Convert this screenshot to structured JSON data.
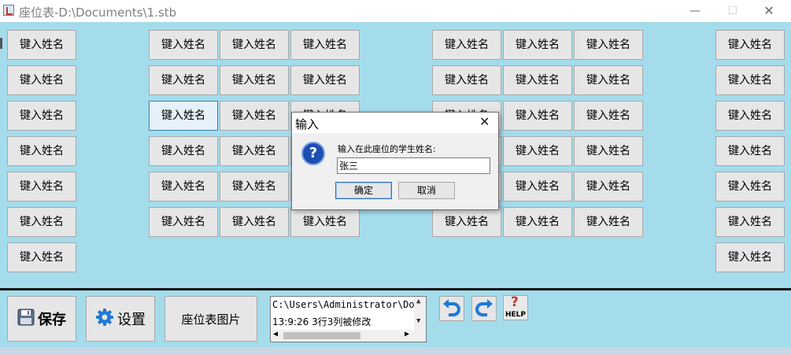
{
  "window": {
    "title": "座位表-D:\\Documents\\1.stb",
    "minimize": "—",
    "maximize": "☐",
    "close": "✕"
  },
  "seat_label": "键入姓名",
  "seats": [
    {
      "row": 1,
      "col": 1
    },
    {
      "row": 1,
      "col": 3
    },
    {
      "row": 1,
      "col": 4
    },
    {
      "row": 1,
      "col": 5
    },
    {
      "row": 1,
      "col": 7
    },
    {
      "row": 1,
      "col": 8
    },
    {
      "row": 1,
      "col": 9
    },
    {
      "row": 1,
      "col": 11
    },
    {
      "row": 2,
      "col": 1
    },
    {
      "row": 2,
      "col": 3
    },
    {
      "row": 2,
      "col": 4
    },
    {
      "row": 2,
      "col": 5
    },
    {
      "row": 2,
      "col": 7
    },
    {
      "row": 2,
      "col": 8
    },
    {
      "row": 2,
      "col": 9
    },
    {
      "row": 2,
      "col": 11
    },
    {
      "row": 3,
      "col": 1
    },
    {
      "row": 3,
      "col": 3,
      "selected": true
    },
    {
      "row": 3,
      "col": 4
    },
    {
      "row": 3,
      "col": 5
    },
    {
      "row": 3,
      "col": 7
    },
    {
      "row": 3,
      "col": 8
    },
    {
      "row": 3,
      "col": 9
    },
    {
      "row": 3,
      "col": 11
    },
    {
      "row": 4,
      "col": 1
    },
    {
      "row": 4,
      "col": 3
    },
    {
      "row": 4,
      "col": 4
    },
    {
      "row": 4,
      "col": 5
    },
    {
      "row": 4,
      "col": 7
    },
    {
      "row": 4,
      "col": 8
    },
    {
      "row": 4,
      "col": 9
    },
    {
      "row": 4,
      "col": 11
    },
    {
      "row": 5,
      "col": 1
    },
    {
      "row": 5,
      "col": 3
    },
    {
      "row": 5,
      "col": 4
    },
    {
      "row": 5,
      "col": 5
    },
    {
      "row": 5,
      "col": 7
    },
    {
      "row": 5,
      "col": 8
    },
    {
      "row": 5,
      "col": 9
    },
    {
      "row": 5,
      "col": 11
    },
    {
      "row": 6,
      "col": 1
    },
    {
      "row": 6,
      "col": 3
    },
    {
      "row": 6,
      "col": 4
    },
    {
      "row": 6,
      "col": 5
    },
    {
      "row": 6,
      "col": 7
    },
    {
      "row": 6,
      "col": 8
    },
    {
      "row": 6,
      "col": 9
    },
    {
      "row": 6,
      "col": 11
    },
    {
      "row": 7,
      "col": 1
    },
    {
      "row": 7,
      "col": 11
    }
  ],
  "toolbar": {
    "save_label": "保存",
    "settings_label": "设置",
    "picture_label": "座位表图片",
    "help_label": "HELP",
    "help_glyph": "?"
  },
  "log": {
    "line1": "C:\\Users\\Administrator\\Doc",
    "line2": "13:9:26 3行3列被修改"
  },
  "dialog": {
    "title": "输入",
    "close": "✕",
    "prompt": "输入在此座位的学生姓名:",
    "input_value": "张三",
    "ok_label": "确定",
    "cancel_label": "取消"
  },
  "colors": {
    "background": "#a4dcec",
    "button": "#e6e6e6",
    "selected_seat": "#e5f1fb"
  }
}
